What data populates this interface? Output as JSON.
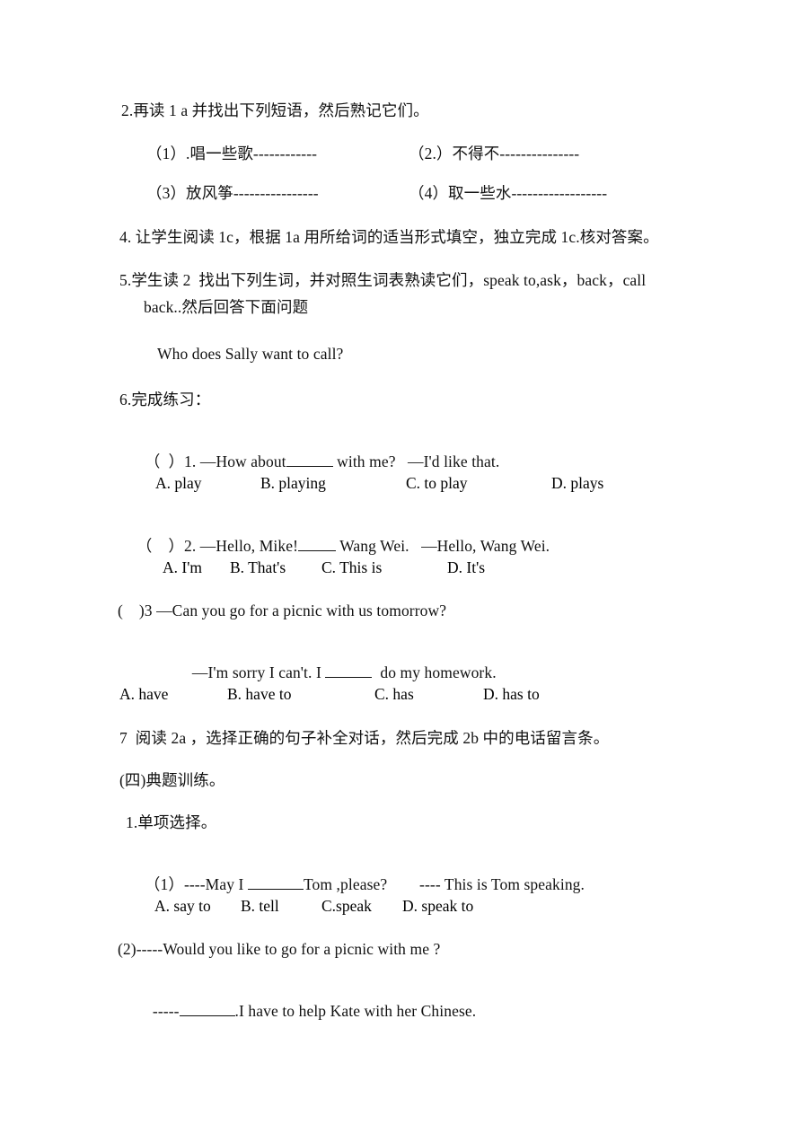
{
  "document": {
    "type": "lesson-plan-worksheet",
    "language": "zh-CN with English exercises",
    "page_background": "#ffffff",
    "text_color": "#111111"
  },
  "lines": {
    "item2_heading": "2.再读 1 a 并找出下列短语，然后熟记它们。",
    "phrase1": "（1）.唱一些歌------------",
    "phrase2": "（2.）不得不---------------",
    "phrase3": "（3）放风筝----------------",
    "phrase4": "（4）取一些水------------------",
    "item4": "4. 让学生阅读 1c，根据 1a 用所给词的适当形式填空，独立完成 1c.核对答案。",
    "item5_line1": "5.学生读 2  找出下列生词，并对照生词表熟读它们，speak to,ask，back，call",
    "item5_line2": "back..然后回答下面问题",
    "item5_question": "Who does Sally want to call?",
    "item6_heading": "6.完成练习：",
    "q1_prefix": "（  ）1. —How about",
    "q1_suffix": "with me?   —I'd like that.",
    "q1_options": [
      "A. play",
      "B. playing",
      "C. to play",
      "D. plays"
    ],
    "q2_prefix": "（    ）2. —Hello, Mike!",
    "q2_suffix": "Wang Wei.   —Hello, Wang Wei.",
    "q2_options": [
      "A. I'm",
      "B. That's",
      "C. This is",
      "D. It's"
    ],
    "q3_line1": "(    )3 —Can you go for a picnic with us tomorrow?",
    "q3_line2_prefix": "—I'm sorry I can't. I",
    "q3_line2_suffix": "do my homework.",
    "q3_options": [
      "A. have",
      "B. have to",
      "C. has",
      "D. has to"
    ],
    "item7": "7  阅读 2a ，选择正确的句子补全对话，然后完成 2b 中的电话留言条。",
    "section4_heading": "(四)典题训练。",
    "sub1_heading": "1.单项选择。",
    "t1_prefix": "（1）----May I",
    "t1_mid": "Tom ,please?",
    "t1_suffix": "---- This is Tom speaking.",
    "t1_options": [
      "A. say to",
      "B. tell",
      "C.speak",
      "D. speak to"
    ],
    "t2_line1": "(2)-----Would you like to go for a picnic with me ?",
    "t2_line2_prefix": "-----",
    "t2_line2_suffix": ".I have to help Kate with her Chinese."
  }
}
